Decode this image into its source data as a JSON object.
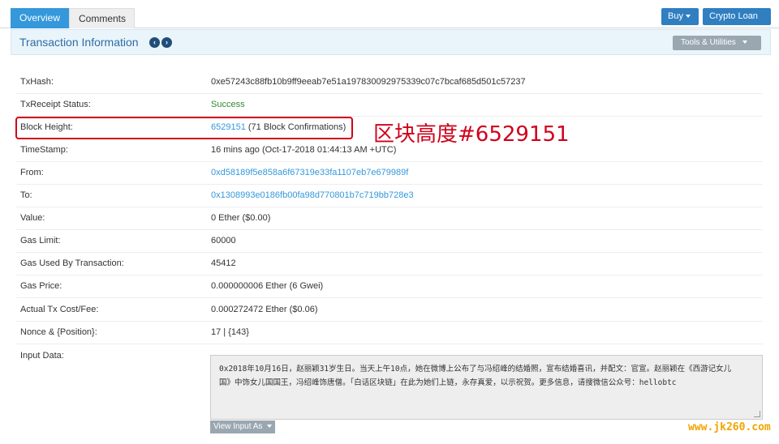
{
  "tabs": {
    "overview": "Overview",
    "comments": "Comments"
  },
  "top_buttons": {
    "buy": "Buy",
    "crypto_loan": "Crypto Loan"
  },
  "panel": {
    "title": "Transaction Information",
    "tools": "Tools & Utilities"
  },
  "rows": [
    {
      "label": "TxHash:",
      "value": "0xe57243c88fb10b9ff9eeab7e51a197830092975339c07c7bcaf685d501c57237"
    },
    {
      "label": "TxReceipt Status:",
      "value": "Success"
    },
    {
      "label": "Block Height:",
      "value": "6529151",
      "extra": " (71 Block Confirmations)"
    },
    {
      "label": "TimeStamp:",
      "value": "16 mins ago (Oct-17-2018 01:44:13 AM +UTC)"
    },
    {
      "label": "From:",
      "value": "0xd58189f5e858a6f67319e33fa1107eb7e679989f"
    },
    {
      "label": "To:",
      "value": "0x1308993e0186fb00fa98d770801b7c719bb728e3"
    },
    {
      "label": "Value:",
      "value": "0 Ether ($0.00)"
    },
    {
      "label": "Gas Limit:",
      "value": "60000"
    },
    {
      "label": "Gas Used By Transaction:",
      "value": "45412"
    },
    {
      "label": "Gas Price:",
      "value": "0.000000006 Ether (6 Gwei)"
    },
    {
      "label": "Actual Tx Cost/Fee:",
      "value": "0.000272472 Ether ($0.06)"
    },
    {
      "label": "Nonce & {Position}:",
      "value": "17 | {143}"
    },
    {
      "label": "Input Data:",
      "value": ""
    }
  ],
  "input_data": {
    "line1": "0x2018年10月16日，赵丽颖31岁生日。当天上午10点，她在微博上公布了与冯绍峰的结婚照，宣布结婚喜讯，并配文：官宣。赵丽颖在《西游记女儿",
    "line2": "国》中饰女儿国国王，冯绍峰饰唐僧。「白话区块链」在此为她们上链，永存真爱，以示祝贺。更多信息，请搜微信公众号：hellobtc"
  },
  "view_input": "View Input As",
  "annotation": "区块高度#6529151",
  "watermark": "www.jk260.com",
  "colors": {
    "accent": "#3498db",
    "success": "#2e8b2e",
    "annotation": "#d0021b"
  }
}
